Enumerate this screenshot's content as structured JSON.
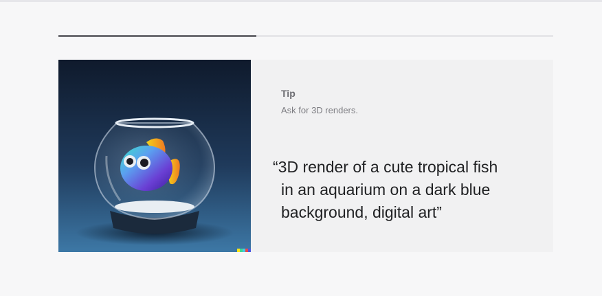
{
  "progress": {
    "value": 0.4
  },
  "tip": {
    "title": "Tip",
    "subtitle": "Ask for 3D renders."
  },
  "quote": {
    "lines": [
      "“3D render of a cute tropical fish",
      "in an aquarium on a dark blue",
      "background, digital art”"
    ]
  },
  "image": {
    "depicts": "fish-in-bowl",
    "colors": {
      "background_top": "#0f1a2c",
      "background_bottom": "#3b6f9a"
    }
  },
  "dalle_mark": {
    "colors": [
      "#f8e71c",
      "#41d88a",
      "#47c7e6",
      "#e8484c",
      "#4a56e2"
    ]
  }
}
